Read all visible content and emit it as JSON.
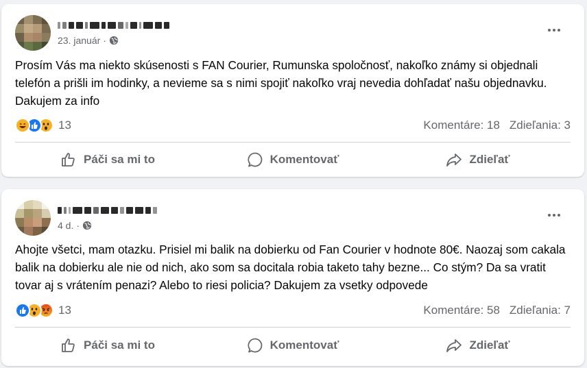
{
  "posts": [
    {
      "date": "23. január",
      "text": "Prosím Vás ma niekto skúsenosti s FAN Courier, Rumunska spoločnosť, nakoľko známy si objednali telefón a prišli im hodinky, a nevieme sa s nimi spojiť nakoľko vraj nevedia dohľadať našu objednavku. Dakujem za info",
      "reactions": [
        "haha",
        "like",
        "wow"
      ],
      "reaction_count": "13",
      "comments": "Komentáre: 18",
      "shares": "Zdieľania: 3"
    },
    {
      "date": "4 d.",
      "text": "Ahojte všetci, mam otazku. Prisiel mi balik na dobierku od Fan Courier v hodnote 80€. Naozaj som cakala balik na dobierku ale nie od nich, ako som sa docitala robia taketo tahy bezne... Co stým? Da sa vratit tovar aj s vrátením penazi? Alebo to riesi policia? Dakujem za vsetky odpovede",
      "reactions": [
        "like",
        "wow",
        "angry"
      ],
      "reaction_count": "13",
      "comments": "Komentáre: 58",
      "shares": "Zdieľania: 7"
    }
  ],
  "actions": {
    "like": "Páči sa mi to",
    "comment": "Komentovať",
    "share": "Zdieľať"
  },
  "icons": {
    "privacy": "globe-icon",
    "menu": "more-options-icon",
    "like": "thumbs-up-icon",
    "comment": "speech-bubble-icon",
    "share": "share-arrow-icon"
  },
  "colors": {
    "background": "#f0f2f5",
    "card": "#ffffff",
    "secondary_text": "#65676b",
    "like_blue": "#1877f2",
    "reaction_yellow": "#f7b125",
    "angry_red": "#e9710f"
  }
}
